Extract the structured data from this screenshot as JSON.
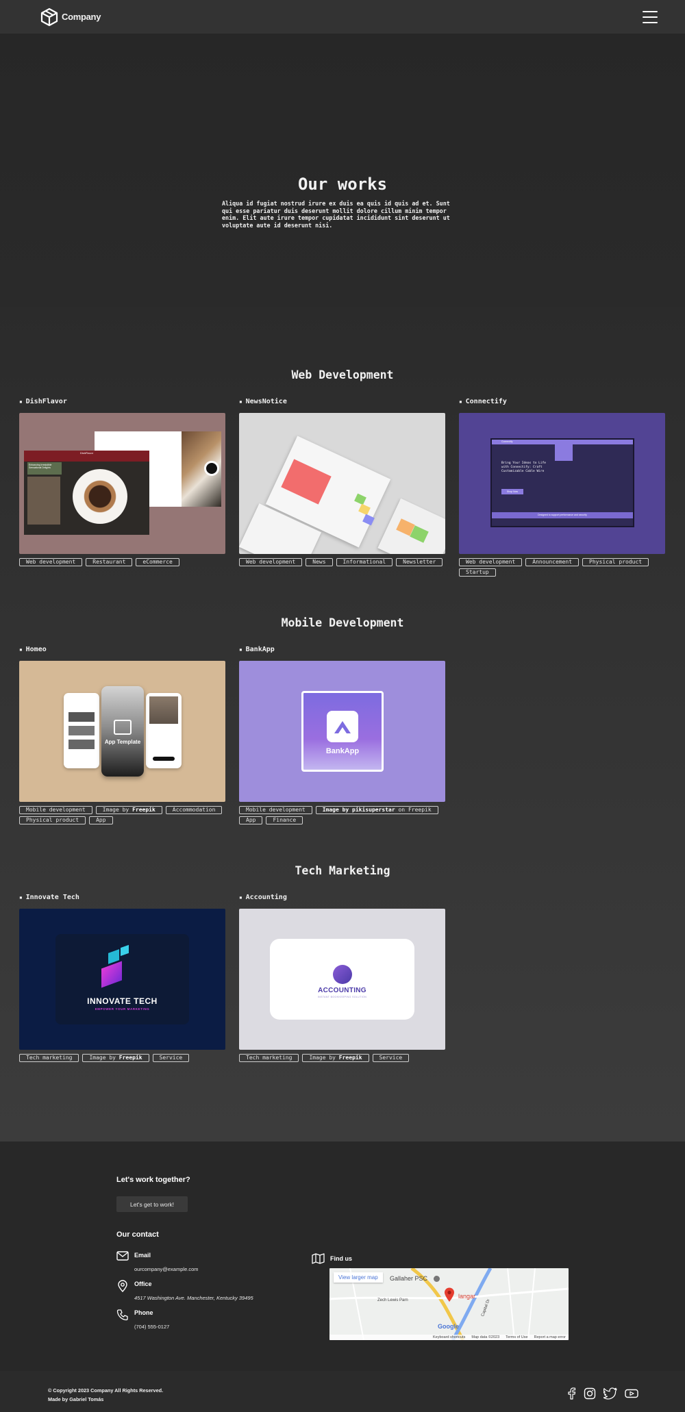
{
  "header": {
    "brand": "Company",
    "menu_icon": "hamburger-menu-icon"
  },
  "hero": {
    "title": "Our works",
    "text": "Aliqua id fugiat nostrud irure ex duis ea quis id quis ad et. Sunt qui esse pariatur duis deserunt mollit dolore cillum minim tempor enim. Elit aute irure tempor cupidatat incididunt sint deserunt ut voluptate aute id deserunt nisi."
  },
  "sections": [
    {
      "title": "Web Development",
      "projects": [
        {
          "name": "DishFlavor",
          "thumb_color": "#957675",
          "tags": [
            "Web development",
            "Restaurant",
            "eCommerce"
          ]
        },
        {
          "name": "NewsNotice",
          "thumb_color": "#d9d9d9",
          "tags": [
            "Web development",
            "News",
            "Informational",
            "Newsletter"
          ]
        },
        {
          "name": "Connectify",
          "thumb_color": "#524494",
          "tags": [
            "Web development",
            "Announcement",
            "Physical product",
            "Startup"
          ]
        }
      ]
    },
    {
      "title": "Mobile Development",
      "projects": [
        {
          "name": "Homeo",
          "thumb_color": "#d5b996",
          "tags": [
            "Mobile development",
            "Image by Freepik",
            "Accommodation",
            "Physical product",
            "App"
          ]
        },
        {
          "name": "BankApp",
          "thumb_color": "#9e8edc",
          "tags": [
            "Mobile development",
            "Image by pikisuperstar on Freepik",
            "App",
            "Finance"
          ]
        }
      ]
    },
    {
      "title": "Tech Marketing",
      "projects": [
        {
          "name": "Innovate Tech",
          "thumb_color": "#0b1c44",
          "tags": [
            "Tech marketing",
            "Image by Freepik",
            "Service"
          ]
        },
        {
          "name": "Accounting",
          "thumb_color": "#dcdbe1",
          "tags": [
            "Tech marketing",
            "Image by Freepik",
            "Service"
          ]
        }
      ]
    }
  ],
  "thumb_texts": {
    "dishflavor_brand": "DishFlavor",
    "dishflavor_headline": "Enhancing Irresistible Sensational Delights",
    "connectify_brand": "Connectify",
    "connectify_headline": "Bring Your Ideas to Life with Connectify: Craft Customizable Cable Wire",
    "connectify_btn": "Shop Now",
    "connectify_bar": "Designed to support performance and security",
    "homeo_title": "App Template",
    "bankapp_logo": "BankApp",
    "innovate_title": "INNOVATE TECH",
    "innovate_sub": "EMPOWER YOUR MARKETING",
    "accounting_title": "ACCOUNTING",
    "accounting_sub": "INSTANT BOOKKEEPING SOLUTION"
  },
  "footer": {
    "cta_title": "Let's work together?",
    "cta_button": "Let's get to work!",
    "contact_title": "Our contact",
    "email_label": "Email",
    "email_value": "ourcompany@example.com",
    "office_label": "Office",
    "office_value": "4517 Washington Ave. Manchester, Kentucky 39495",
    "phone_label": "Phone",
    "phone_value": "(704) 555-0127",
    "findus_label": "Find us",
    "map": {
      "link": "View larger map",
      "place1": "Gallaher PSC",
      "place2": "langar",
      "road1": "Zech Lewis Parn",
      "road2": "Capital Dr",
      "attribution_keys": "Keyboard shortcuts",
      "attribution_data": "Map data ©2023",
      "attribution_terms": "Terms of Use",
      "attribution_report": "Report a map error",
      "google": "Google"
    }
  },
  "bottom": {
    "copyright": "© Copyright 2023 Company All Rights Reserved.",
    "made_by": "Made by Gabriel Tomás",
    "socials": [
      "facebook-icon",
      "instagram-icon",
      "twitter-icon",
      "youtube-icon"
    ]
  }
}
